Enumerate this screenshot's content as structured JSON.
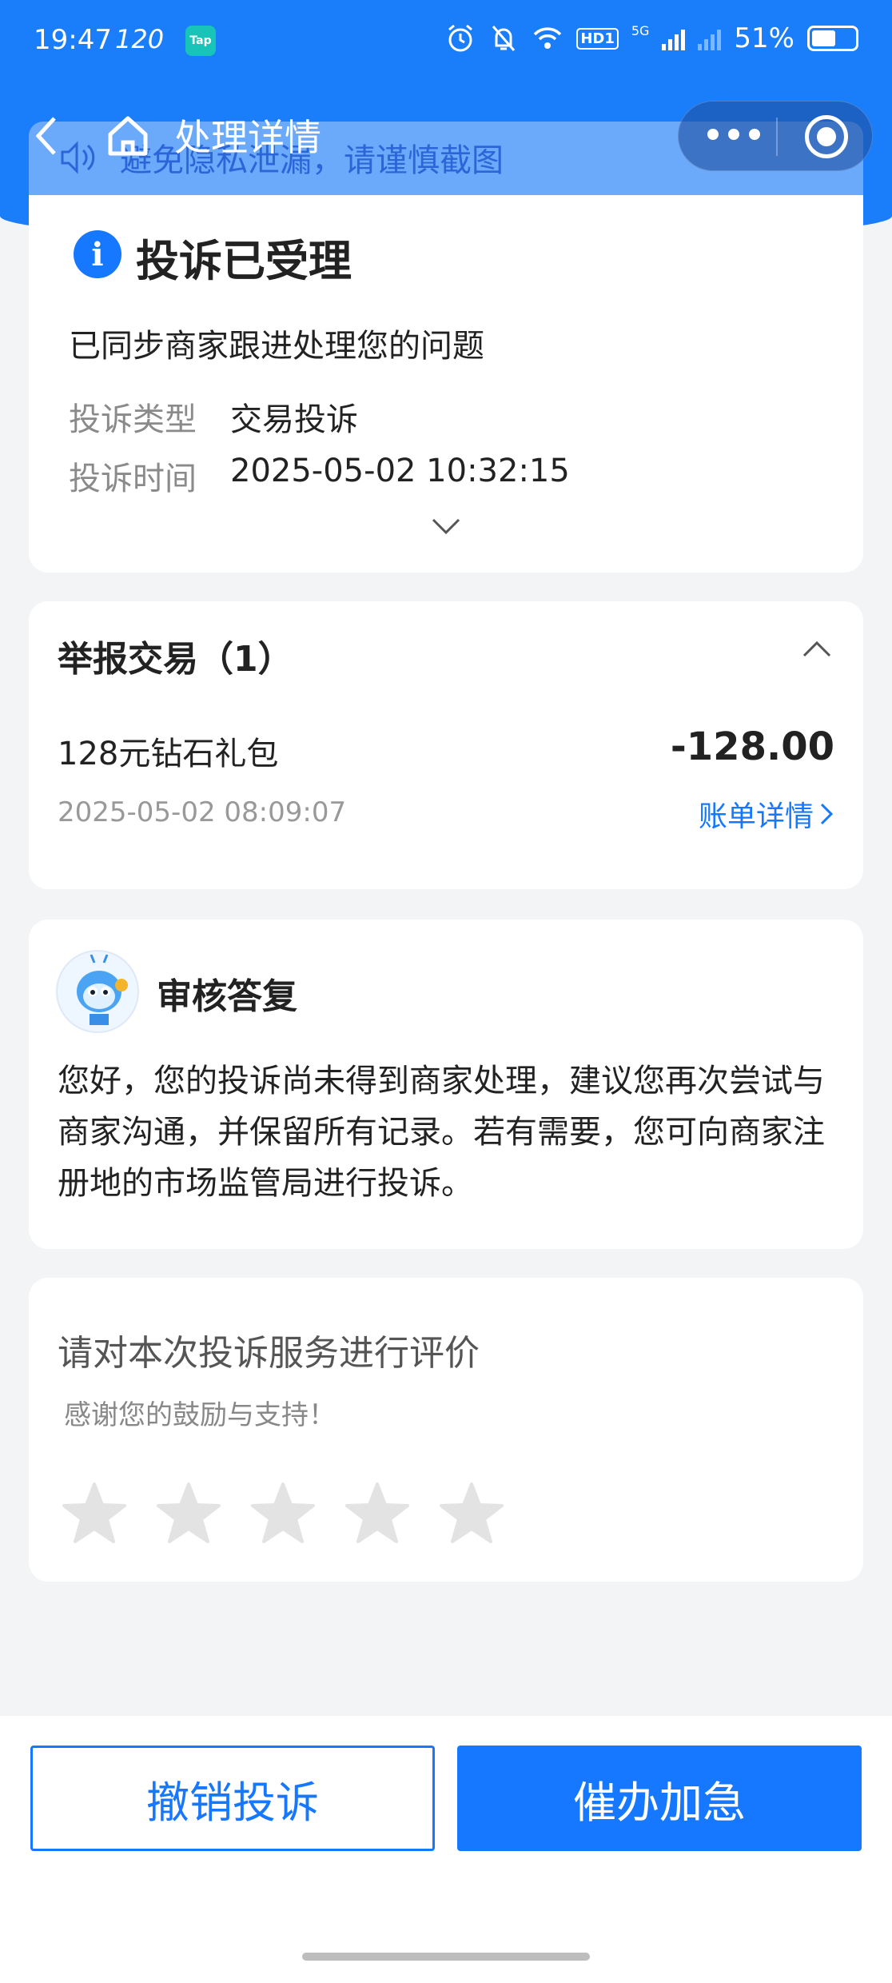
{
  "status_bar": {
    "time": "19:47",
    "refresh_rate": "120",
    "app_badge": "Tap",
    "hd_label": "HD1",
    "network": "5G",
    "battery": "51%"
  },
  "nav": {
    "title": "处理详情"
  },
  "notice": {
    "text": "避免隐私泄漏，请谨慎截图"
  },
  "status_card": {
    "icon_letter": "i",
    "title": "投诉已受理",
    "description": "已同步商家跟进处理您的问题",
    "fields": [
      {
        "label": "投诉类型",
        "value": "交易投诉"
      },
      {
        "label": "投诉时间",
        "value": "2025-05-02 10:32:15"
      }
    ]
  },
  "transaction_card": {
    "title": "举报交易（1）",
    "item_name": "128元钻石礼包",
    "amount": "-128.00",
    "time": "2025-05-02 08:09:07",
    "detail_link": "账单详情"
  },
  "reply_card": {
    "title": "审核答复",
    "content": "您好，您的投诉尚未得到商家处理，建议您再次尝试与商家沟通，并保留所有记录。若有需要，您可向商家注册地的市场监管局进行投诉。"
  },
  "rating_card": {
    "title": "请对本次投诉服务进行评价",
    "subtitle": "感谢您的鼓励与支持！",
    "stars_selected": 0,
    "stars_total": 5
  },
  "actions": {
    "cancel_label": "撤销投诉",
    "urge_label": "催办加急"
  },
  "colors": {
    "primary": "#1677ff",
    "header": "#1a7dfa",
    "background": "#f3f4f6"
  }
}
